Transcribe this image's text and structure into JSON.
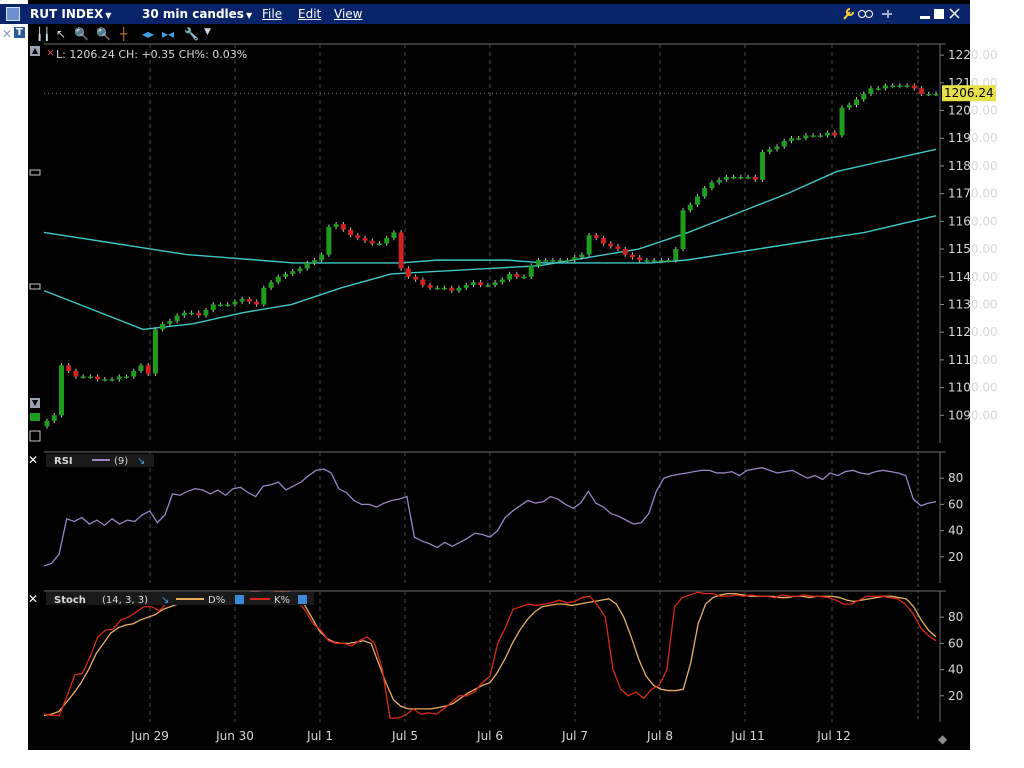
{
  "titlebar": {
    "symbol": "RUT INDEX",
    "interval": "30 min candles",
    "menu": [
      "File",
      "Edit",
      "View"
    ]
  },
  "price_panel": {
    "readout": "L: 1206.24 CH: +0.35 CH%: 0.03%",
    "last_tag": "1206.24",
    "y_ticks": [
      "1220.00",
      "1210.00",
      "1200.00",
      "1190.00",
      "1180.00",
      "1170.00",
      "1160.00",
      "1150.00",
      "1140.00",
      "1130.00",
      "1120.00",
      "1110.00",
      "1100.00",
      "1090.00"
    ]
  },
  "rsi_panel": {
    "name": "RSI",
    "param": "(9)",
    "y_ticks": [
      "80",
      "60",
      "40",
      "20"
    ]
  },
  "stoch_panel": {
    "name": "Stoch",
    "params": "(14, 3, 3)",
    "d_label": "D%",
    "k_label": "K%",
    "y_ticks": [
      "80",
      "60",
      "40",
      "20"
    ]
  },
  "x_labels": [
    "Jun 29",
    "Jun 30",
    "Jul 1",
    "Jul 5",
    "Jul 6",
    "Jul 7",
    "Jul 8",
    "Jul 11",
    "Jul 12"
  ],
  "colors": {
    "up": "#1e9d1e",
    "down": "#d02020",
    "ma": "#40c8c8",
    "rsi": "#9a85c8",
    "stoch_d": "#e8b060",
    "stoch_k": "#d82818",
    "grid": "#4a4a4a",
    "axis_text": "#d8d8d8",
    "last_tag": "#e8e04a"
  },
  "chart_data": [
    {
      "type": "candlestick",
      "title": "RUT INDEX 30 min candles",
      "ylim": [
        1080,
        1224
      ],
      "x": [
        "Jun 29",
        "Jun 30",
        "Jul 1",
        "Jul 5",
        "Jul 6",
        "Jul 7",
        "Jul 8",
        "Jul 11",
        "Jul 12"
      ],
      "closes": [
        1088,
        1090,
        1108,
        1106,
        1104,
        1104,
        1104,
        1103,
        1103,
        1103,
        1104,
        1104,
        1106,
        1108,
        1105,
        1121,
        1123,
        1124,
        1126,
        1127,
        1127,
        1126,
        1128,
        1130,
        1130,
        1130,
        1131,
        1132,
        1131,
        1130,
        1136,
        1138,
        1140,
        1141,
        1142,
        1143,
        1145,
        1146,
        1148,
        1158,
        1159,
        1157,
        1155,
        1154,
        1153,
        1152,
        1152,
        1154,
        1156,
        1143,
        1140,
        1139,
        1137,
        1136,
        1136,
        1136,
        1135,
        1136,
        1137,
        1138,
        1137,
        1137,
        1138,
        1139,
        1141,
        1140,
        1140,
        1144,
        1146,
        1146,
        1146,
        1146,
        1146,
        1147,
        1148,
        1155,
        1154,
        1152,
        1151,
        1150,
        1148,
        1147,
        1146,
        1146,
        1146,
        1146,
        1146,
        1150,
        1164,
        1166,
        1169,
        1172,
        1174,
        1175,
        1176,
        1176,
        1176,
        1176,
        1175,
        1185,
        1186,
        1187,
        1189,
        1190,
        1190,
        1191,
        1191,
        1191,
        1192,
        1191,
        1201,
        1202,
        1204,
        1206,
        1208,
        1208,
        1209,
        1209,
        1209,
        1209,
        1208,
        1206,
        1206,
        1206
      ],
      "ma_long": [
        1156,
        1154,
        1152,
        1150,
        1148,
        1147,
        1146,
        1145,
        1145,
        1145,
        1145,
        1146,
        1146,
        1146,
        1145,
        1145,
        1145,
        1145,
        1146,
        1148,
        1150,
        1152,
        1154,
        1156,
        1159,
        1162
      ],
      "ma_short": [
        1135,
        1128,
        1121,
        1123,
        1127,
        1130,
        1136,
        1141,
        1142,
        1143,
        1144,
        1147,
        1150,
        1156,
        1163,
        1170,
        1178,
        1182,
        1186
      ]
    },
    {
      "type": "line",
      "title": "RSI (9)",
      "ylim": [
        0,
        100
      ],
      "series": [
        {
          "name": "RSI",
          "values": [
            13,
            15,
            22,
            49,
            47,
            50,
            45,
            48,
            44,
            49,
            45,
            48,
            47,
            52,
            55,
            46,
            52,
            68,
            67,
            70,
            72,
            71,
            68,
            71,
            67,
            72,
            73,
            69,
            66,
            74,
            75,
            77,
            71,
            74,
            77,
            82,
            86,
            87,
            84,
            72,
            69,
            63,
            60,
            60,
            58,
            61,
            63,
            64,
            66,
            35,
            32,
            30,
            27,
            31,
            28,
            31,
            34,
            38,
            37,
            35,
            40,
            50,
            55,
            59,
            63,
            61,
            62,
            66,
            64,
            60,
            57,
            61,
            70,
            61,
            58,
            53,
            51,
            48,
            45,
            46,
            53,
            70,
            80,
            82,
            83,
            84,
            85,
            86,
            86,
            84,
            84,
            85,
            82,
            86,
            87,
            88,
            86,
            84,
            85,
            86,
            83,
            80,
            82,
            79,
            84,
            82,
            85,
            86,
            84,
            83,
            85,
            86,
            85,
            84,
            82,
            64,
            59,
            61,
            62
          ]
        }
      ]
    },
    {
      "type": "line",
      "title": "Stoch (14, 3, 3)",
      "ylim": [
        0,
        100
      ],
      "series": [
        {
          "name": "D%",
          "values": [
            5,
            6,
            8,
            15,
            22,
            30,
            40,
            52,
            60,
            68,
            72,
            74,
            75,
            78,
            80,
            82,
            86,
            88,
            90,
            92,
            94,
            95,
            96,
            97,
            97,
            96,
            95,
            96,
            97,
            98,
            97,
            98,
            99,
            98,
            95,
            90,
            80,
            70,
            64,
            61,
            60,
            60,
            61,
            62,
            60,
            45,
            30,
            17,
            12,
            10,
            10,
            10,
            10,
            11,
            12,
            14,
            18,
            22,
            25,
            28,
            30,
            38,
            48,
            60,
            70,
            78,
            84,
            88,
            89,
            90,
            90,
            89,
            90,
            91,
            92,
            93,
            94,
            90,
            80,
            65,
            48,
            35,
            28,
            25,
            24,
            24,
            25,
            45,
            75,
            90,
            95,
            97,
            98,
            98,
            97,
            96,
            96,
            96,
            96,
            95,
            95,
            96,
            96,
            95,
            96,
            96,
            96,
            95,
            93,
            92,
            93,
            94,
            95,
            96,
            96,
            95,
            94,
            88,
            78,
            70,
            65
          ]
        },
        {
          "name": "K%",
          "values": [
            6,
            5,
            5,
            20,
            36,
            37,
            50,
            65,
            70,
            71,
            78,
            80,
            84,
            88,
            88,
            85,
            91,
            95,
            96,
            96,
            97,
            97,
            97,
            97,
            92,
            94,
            98,
            99,
            99,
            98,
            99,
            99,
            99,
            92,
            85,
            75,
            70,
            62,
            60,
            60,
            58,
            62,
            65,
            60,
            40,
            3,
            3,
            5,
            10,
            6,
            7,
            6,
            10,
            15,
            20,
            20,
            23,
            30,
            35,
            60,
            72,
            86,
            88,
            90,
            89,
            90,
            91,
            93,
            91,
            92,
            95,
            96,
            89,
            80,
            40,
            25,
            20,
            23,
            18,
            25,
            28,
            40,
            88,
            95,
            97,
            99,
            98,
            98,
            96,
            96,
            97,
            96,
            97,
            96,
            96,
            95,
            97,
            96,
            96,
            97,
            96,
            96,
            95,
            93,
            90,
            90,
            93,
            96,
            96,
            96,
            95,
            94,
            90,
            83,
            72,
            66,
            62
          ]
        }
      ]
    }
  ]
}
